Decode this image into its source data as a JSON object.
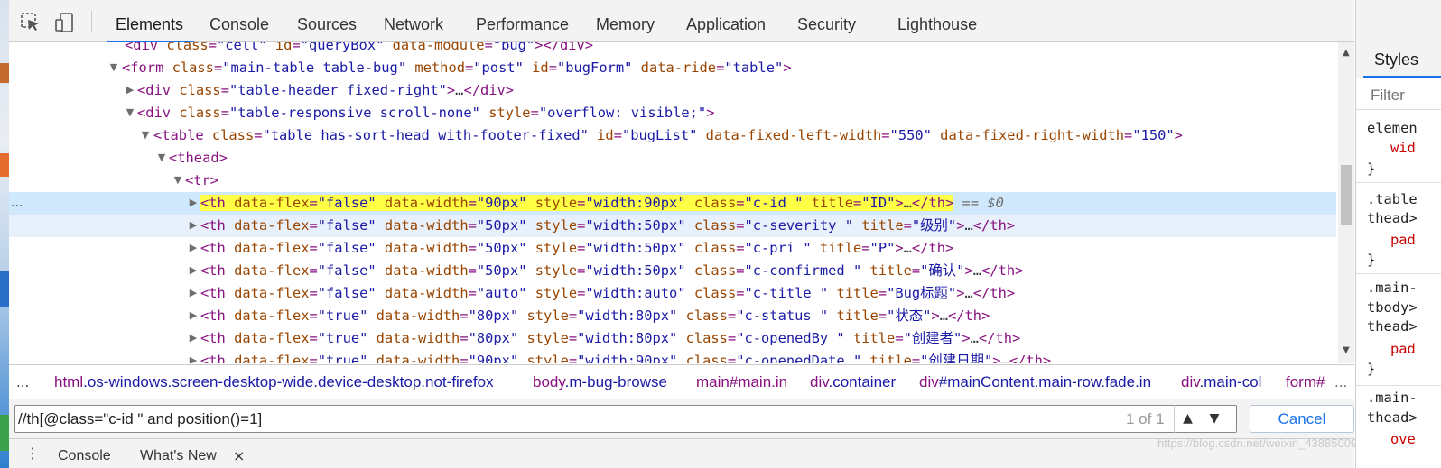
{
  "tabs": [
    "Elements",
    "Console",
    "Sources",
    "Network",
    "Performance",
    "Memory",
    "Application",
    "Security",
    "Lighthouse"
  ],
  "active_tab": "Elements",
  "toolbar": {
    "inspect_icon": "inspect-cursor-icon",
    "device_icon": "device-toggle-icon"
  },
  "dom": {
    "lines": [
      {
        "kind": "partial",
        "text_tag_open": "<div ",
        "a1": "class",
        "v1": "\"cell\"",
        "a2": "id",
        "v2": "\"queryBox\"",
        "a3": "data-module",
        "v3": "\"bug\"",
        "tail": "></div>"
      },
      {
        "text": "<form class=\"main-table table-bug\" method=\"post\" id=\"bugForm\" data-ride=\"table\">"
      },
      {
        "text": "<div class=\"table-header fixed-right\">…</div>"
      },
      {
        "text": "<div class=\"table-responsive scroll-none\" style=\"overflow: visible;\">"
      },
      {
        "text": "<table class=\"table has-sort-head with-footer-fixed\" id=\"bugList\" data-fixed-left-width=\"550\" data-fixed-right-width=\"150\">"
      },
      {
        "text": "<thead>"
      },
      {
        "text": "<tr>"
      },
      {
        "text": "<th data-flex=\"false\" data-width=\"90px\" style=\"width:90px\" class=\"c-id \" title=\"ID\">…</th>",
        "suffix": " == $0"
      },
      {
        "text": "<th data-flex=\"false\" data-width=\"50px\" style=\"width:50px\" class=\"c-severity \" title=\"级别\">…</th>"
      },
      {
        "text": "<th data-flex=\"false\" data-width=\"50px\" style=\"width:50px\" class=\"c-pri \" title=\"P\">…</th>"
      },
      {
        "text": "<th data-flex=\"false\" data-width=\"50px\" style=\"width:50px\" class=\"c-confirmed \" title=\"确认\">…</th>"
      },
      {
        "text": "<th data-flex=\"false\" data-width=\"auto\" style=\"width:auto\" class=\"c-title \" title=\"Bug标题\">…</th>"
      },
      {
        "text": "<th data-flex=\"true\" data-width=\"80px\" style=\"width:80px\" class=\"c-status \" title=\"状态\">…</th>"
      },
      {
        "text": "<th data-flex=\"true\" data-width=\"80px\" style=\"width:80px\" class=\"c-openedBy \" title=\"创建者\">…</th>"
      },
      {
        "text": "<th data-flex=\"true\" data-width=\"90px\" style=\"width:90px\" class=\"c-openedDate \" title=\"创建日期\">…</th>"
      }
    ],
    "selected_marker": "...",
    "selected_suffix": "== $0"
  },
  "breadcrumb": {
    "more": "...",
    "items": [
      {
        "tag": "html",
        "rest": ".os-windows.screen-desktop-wide.device-desktop.not-firefox"
      },
      {
        "tag": "body",
        "rest": ".m-bug-browse"
      },
      {
        "tag": "main",
        "rest": "#main.in"
      },
      {
        "tag": "div",
        "rest": ".container"
      },
      {
        "tag": "div",
        "rest": "#mainContent.main-row.fade.in"
      },
      {
        "tag": "div",
        "rest": ".main-col"
      },
      {
        "tag": "form",
        "rest": "#"
      }
    ],
    "more_right": "..."
  },
  "search": {
    "value": "//th[@class=\"c-id \" and position()=1]",
    "count": "1 of 1",
    "cancel": "Cancel"
  },
  "drawer": {
    "tabs": [
      "Console",
      "What's New"
    ],
    "close": "×",
    "menu": "⋮"
  },
  "watermark": "https://blog.csdn.net/weixin_43885009",
  "styles": {
    "tab": "Styles",
    "filter_placeholder": "Filter",
    "rules": [
      {
        "lines": [
          {
            "t": "elemen",
            "c": "sel"
          },
          {
            "t": "wid",
            "c": "prop",
            "indent": true
          },
          {
            "t": "}",
            "c": "brace"
          }
        ]
      },
      {
        "lines": [
          {
            "t": ".table",
            "c": "sel"
          },
          {
            "t": "thead>",
            "c": "sel"
          },
          {
            "t": "pad",
            "c": "prop",
            "indent": true
          },
          {
            "t": "}",
            "c": "brace"
          }
        ]
      },
      {
        "lines": [
          {
            "t": ".main-",
            "c": "sel"
          },
          {
            "t": "tbody>",
            "c": "sel"
          },
          {
            "t": "thead>",
            "c": "sel"
          },
          {
            "t": "pad",
            "c": "prop",
            "indent": true
          },
          {
            "t": "}",
            "c": "brace"
          }
        ]
      },
      {
        "lines": [
          {
            "t": ".main-",
            "c": "sel"
          },
          {
            "t": "thead>",
            "c": "sel"
          },
          {
            "t": "ove",
            "c": "prop",
            "indent": true
          }
        ]
      }
    ]
  },
  "colors": {
    "selection": "#cfe8fc",
    "highlight": "#ffff46",
    "accent": "#1a73e8",
    "tag": "#881280",
    "attr_name": "#994500",
    "attr_value": "#1a1aa6"
  }
}
